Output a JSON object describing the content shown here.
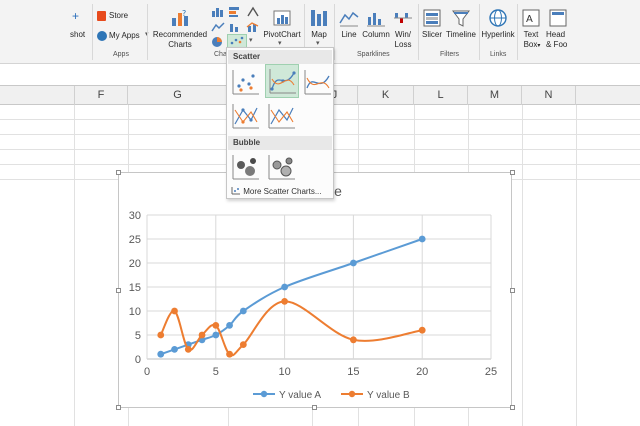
{
  "ribbon": {
    "partial_left": "+",
    "partial_left2": "shot",
    "store_label": "Store",
    "myapps_label": "My Apps",
    "apps_group": "Apps",
    "recommended_label": "Recommended",
    "recommended_label2": "Charts",
    "charts_group_partial": "Char",
    "pivotchart_label": "PivotChart",
    "map_label": "Map",
    "line_label": "Line",
    "column_label": "Column",
    "winloss_label": "Win/",
    "winloss_label2": "Loss",
    "sparklines_group": "Sparklines",
    "slicer_label": "Slicer",
    "timeline_label": "Timeline",
    "filters_group": "Filters",
    "hyperlink_label": "Hyperlink",
    "links_group": "Links",
    "textbox_label": "Text",
    "textbox_label2": "Box",
    "header_label": "Head",
    "header_label2": "& Foo"
  },
  "columns": [
    "F",
    "G",
    "J",
    "K",
    "L",
    "M",
    "N"
  ],
  "dropdown": {
    "scatter_header": "Scatter",
    "bubble_header": "Bubble",
    "more_link": "More Scatter Charts..."
  },
  "chart_data": {
    "type": "scatter",
    "title_partial": "le",
    "xlim": [
      0,
      25
    ],
    "ylim": [
      0,
      30
    ],
    "xticks": [
      0,
      5,
      10,
      15,
      20,
      25
    ],
    "yticks": [
      0,
      5,
      10,
      15,
      20,
      25,
      30
    ],
    "grid": true,
    "legend": "bottom",
    "series": [
      {
        "name": "Y value A",
        "color": "#5b9bd5",
        "x": [
          1,
          2,
          3,
          4,
          5,
          6,
          7,
          10,
          15,
          20
        ],
        "y": [
          1,
          2,
          3,
          4,
          5,
          7,
          10,
          15,
          20,
          25
        ]
      },
      {
        "name": "Y value B",
        "color": "#ed7d31",
        "x": [
          1,
          2,
          3,
          4,
          5,
          6,
          7,
          10,
          15,
          20
        ],
        "y": [
          5,
          10,
          2,
          5,
          7,
          1,
          3,
          12,
          4,
          6
        ]
      }
    ]
  }
}
